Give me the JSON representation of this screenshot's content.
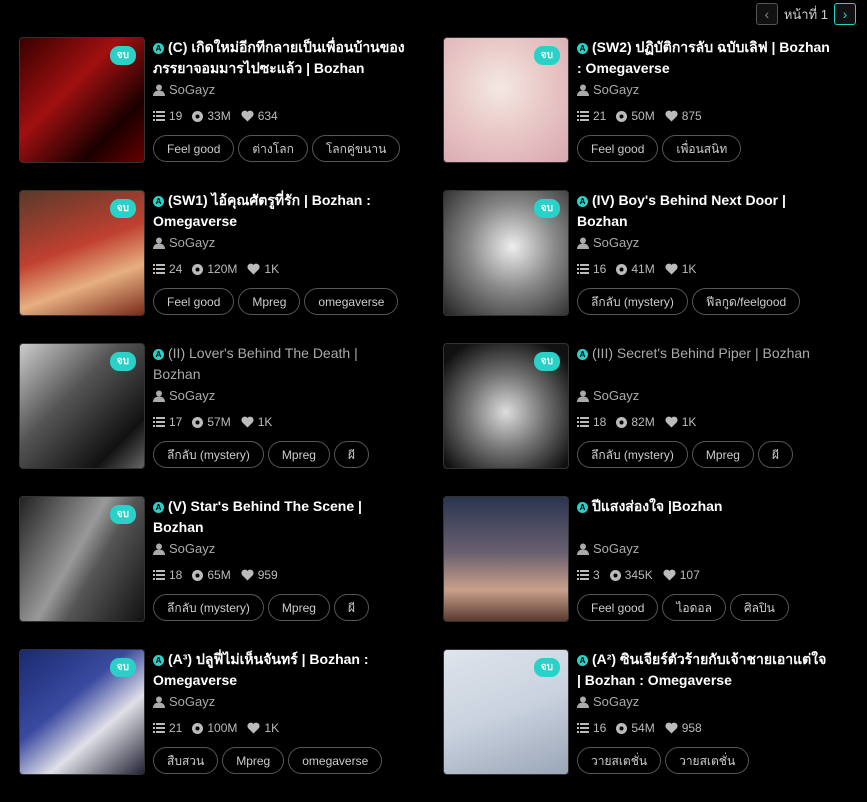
{
  "pagination": {
    "label": "หน้าที่ 1",
    "prev": "‹",
    "next": "›"
  },
  "colors": {
    "accent": "#2ad1c8",
    "bg": "#000000"
  },
  "stories": [
    {
      "badge": "จบ",
      "title": "(C) เกิดใหม่อีกทีกลายเป็นเพื่อนบ้านของภรรยาจอมมารไปซะแล้ว | Bozhan",
      "author": "SoGayz",
      "chapters": "19",
      "views": "33M",
      "likes": "634",
      "tags": [
        "Feel good",
        "ต่างโลก",
        "โลกคู่ขนาน"
      ],
      "dim": false,
      "cover": "red"
    },
    {
      "badge": "จบ",
      "title": "(SW2) ปฏิบัติการลับ ฉบับเลิฟ | Bozhan : Omegaverse",
      "author": "SoGayz",
      "chapters": "21",
      "views": "50M",
      "likes": "875",
      "tags": [
        "Feel good",
        "เพื่อนสนิท"
      ],
      "dim": false,
      "cover": "pink"
    },
    {
      "badge": "จบ",
      "title": "(SW1) ไอ้คุณศัตรูที่รัก | Bozhan : Omegaverse",
      "author": "SoGayz",
      "chapters": "24",
      "views": "120M",
      "likes": "1K",
      "tags": [
        "Feel good",
        "Mpreg",
        "omegaverse"
      ],
      "dim": false,
      "cover": "floral"
    },
    {
      "badge": "จบ",
      "title": "(IV) Boy's Behind Next Door | Bozhan",
      "author": "SoGayz",
      "chapters": "16",
      "views": "41M",
      "likes": "1K",
      "tags": [
        "ลึกลับ (mystery)",
        "ฟีลกูด/feelgood"
      ],
      "dim": false,
      "cover": "bw"
    },
    {
      "badge": "จบ",
      "title": "(II) Lover's Behind The Death | Bozhan",
      "author": "SoGayz",
      "chapters": "17",
      "views": "57M",
      "likes": "1K",
      "tags": [
        "ลึกลับ (mystery)",
        "Mpreg",
        "ผี"
      ],
      "dim": true,
      "cover": "bw2"
    },
    {
      "badge": "จบ",
      "title": "(III) Secret's Behind Piper | Bozhan",
      "author": "SoGayz",
      "chapters": "18",
      "views": "82M",
      "likes": "1K",
      "tags": [
        "ลึกลับ (mystery)",
        "Mpreg",
        "ผี"
      ],
      "dim": true,
      "cover": "bw3"
    },
    {
      "badge": "จบ",
      "title": "(V) Star's Behind The Scene | Bozhan",
      "author": "SoGayz",
      "chapters": "18",
      "views": "65M",
      "likes": "959",
      "tags": [
        "ลึกลับ (mystery)",
        "Mpreg",
        "ผี"
      ],
      "dim": false,
      "cover": "bw4"
    },
    {
      "badge": "",
      "title": "ปีแสงส่องใจ |Bozhan",
      "author": "SoGayz",
      "chapters": "3",
      "views": "345K",
      "likes": "107",
      "tags": [
        "Feel good",
        "ไอดอล",
        "ศิลปิน"
      ],
      "dim": false,
      "cover": "sunset"
    },
    {
      "badge": "จบ",
      "title": "(A³) ปลูฟี่ไม่เห็นจันทร์ | Bozhan : Omegaverse",
      "author": "SoGayz",
      "chapters": "21",
      "views": "100M",
      "likes": "1K",
      "tags": [
        "สืบสวน",
        "Mpreg",
        "omegaverse"
      ],
      "dim": false,
      "cover": "blue"
    },
    {
      "badge": "จบ",
      "title": "(A²) ซินเจียร์ตัวร้ายกับเจ้าชายเอาแต่ใจ | Bozhan : Omegaverse",
      "author": "SoGayz",
      "chapters": "16",
      "views": "54M",
      "likes": "958",
      "tags": [
        "วายสเตชั่น",
        "วายสเตชั่น"
      ],
      "dim": false,
      "cover": "light"
    }
  ]
}
